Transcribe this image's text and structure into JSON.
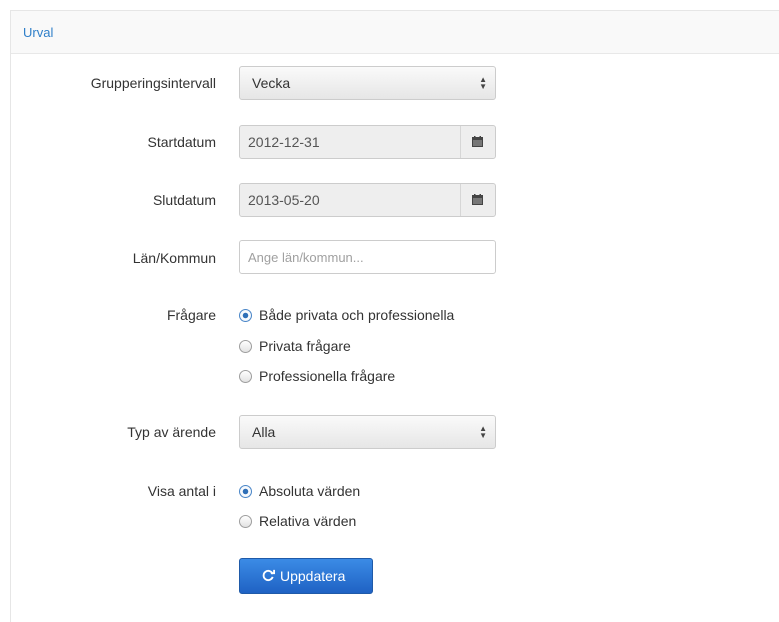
{
  "panel": {
    "title": "Urval"
  },
  "form": {
    "grouping": {
      "label": "Grupperingsintervall",
      "value": "Vecka"
    },
    "start_date": {
      "label": "Startdatum",
      "value": "2012-12-31"
    },
    "end_date": {
      "label": "Slutdatum",
      "value": "2013-05-20"
    },
    "region": {
      "label": "Län/Kommun",
      "placeholder": "Ange län/kommun..."
    },
    "asker": {
      "label": "Frågare",
      "options": [
        "Både privata och professionella",
        "Privata frågare",
        "Professionella frågare"
      ],
      "selected": "Både privata och professionella"
    },
    "case_type": {
      "label": "Typ av ärende",
      "value": "Alla"
    },
    "show_count": {
      "label": "Visa antal i",
      "options": [
        "Absoluta värden",
        "Relativa värden"
      ],
      "selected": "Absoluta värden"
    },
    "update_button": {
      "label": "Uppdatera",
      "icon": "refresh-icon"
    }
  },
  "icons": {
    "calendar": "calendar-icon",
    "select_arrows": "sort-arrows-icon"
  },
  "colors": {
    "accent": "#2f7fc9",
    "button": "#2a72d4"
  }
}
